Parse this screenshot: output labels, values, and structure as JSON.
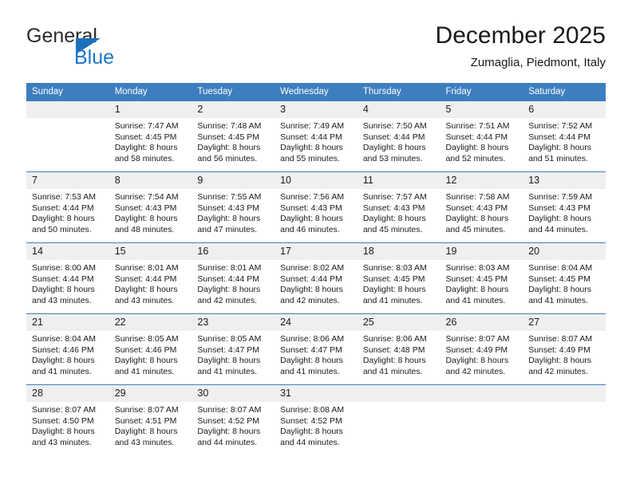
{
  "brand": {
    "name_top": "General",
    "name_bottom": "Blue",
    "accent_color": "#1b76c6"
  },
  "header": {
    "title": "December 2025",
    "subtitle": "Zumaglia, Piedmont, Italy"
  },
  "theme": {
    "header_blue": "#3d7ebf",
    "daynum_gray": "#efefef"
  },
  "weekday_headers": [
    "Sunday",
    "Monday",
    "Tuesday",
    "Wednesday",
    "Thursday",
    "Friday",
    "Saturday"
  ],
  "weeks": [
    [
      {
        "day": "",
        "sunrise": "",
        "sunset": "",
        "daylight_line1": "",
        "daylight_line2": ""
      },
      {
        "day": "1",
        "sunrise": "Sunrise: 7:47 AM",
        "sunset": "Sunset: 4:45 PM",
        "daylight_line1": "Daylight: 8 hours",
        "daylight_line2": "and 58 minutes."
      },
      {
        "day": "2",
        "sunrise": "Sunrise: 7:48 AM",
        "sunset": "Sunset: 4:45 PM",
        "daylight_line1": "Daylight: 8 hours",
        "daylight_line2": "and 56 minutes."
      },
      {
        "day": "3",
        "sunrise": "Sunrise: 7:49 AM",
        "sunset": "Sunset: 4:44 PM",
        "daylight_line1": "Daylight: 8 hours",
        "daylight_line2": "and 55 minutes."
      },
      {
        "day": "4",
        "sunrise": "Sunrise: 7:50 AM",
        "sunset": "Sunset: 4:44 PM",
        "daylight_line1": "Daylight: 8 hours",
        "daylight_line2": "and 53 minutes."
      },
      {
        "day": "5",
        "sunrise": "Sunrise: 7:51 AM",
        "sunset": "Sunset: 4:44 PM",
        "daylight_line1": "Daylight: 8 hours",
        "daylight_line2": "and 52 minutes."
      },
      {
        "day": "6",
        "sunrise": "Sunrise: 7:52 AM",
        "sunset": "Sunset: 4:44 PM",
        "daylight_line1": "Daylight: 8 hours",
        "daylight_line2": "and 51 minutes."
      }
    ],
    [
      {
        "day": "7",
        "sunrise": "Sunrise: 7:53 AM",
        "sunset": "Sunset: 4:44 PM",
        "daylight_line1": "Daylight: 8 hours",
        "daylight_line2": "and 50 minutes."
      },
      {
        "day": "8",
        "sunrise": "Sunrise: 7:54 AM",
        "sunset": "Sunset: 4:43 PM",
        "daylight_line1": "Daylight: 8 hours",
        "daylight_line2": "and 48 minutes."
      },
      {
        "day": "9",
        "sunrise": "Sunrise: 7:55 AM",
        "sunset": "Sunset: 4:43 PM",
        "daylight_line1": "Daylight: 8 hours",
        "daylight_line2": "and 47 minutes."
      },
      {
        "day": "10",
        "sunrise": "Sunrise: 7:56 AM",
        "sunset": "Sunset: 4:43 PM",
        "daylight_line1": "Daylight: 8 hours",
        "daylight_line2": "and 46 minutes."
      },
      {
        "day": "11",
        "sunrise": "Sunrise: 7:57 AM",
        "sunset": "Sunset: 4:43 PM",
        "daylight_line1": "Daylight: 8 hours",
        "daylight_line2": "and 45 minutes."
      },
      {
        "day": "12",
        "sunrise": "Sunrise: 7:58 AM",
        "sunset": "Sunset: 4:43 PM",
        "daylight_line1": "Daylight: 8 hours",
        "daylight_line2": "and 45 minutes."
      },
      {
        "day": "13",
        "sunrise": "Sunrise: 7:59 AM",
        "sunset": "Sunset: 4:43 PM",
        "daylight_line1": "Daylight: 8 hours",
        "daylight_line2": "and 44 minutes."
      }
    ],
    [
      {
        "day": "14",
        "sunrise": "Sunrise: 8:00 AM",
        "sunset": "Sunset: 4:44 PM",
        "daylight_line1": "Daylight: 8 hours",
        "daylight_line2": "and 43 minutes."
      },
      {
        "day": "15",
        "sunrise": "Sunrise: 8:01 AM",
        "sunset": "Sunset: 4:44 PM",
        "daylight_line1": "Daylight: 8 hours",
        "daylight_line2": "and 43 minutes."
      },
      {
        "day": "16",
        "sunrise": "Sunrise: 8:01 AM",
        "sunset": "Sunset: 4:44 PM",
        "daylight_line1": "Daylight: 8 hours",
        "daylight_line2": "and 42 minutes."
      },
      {
        "day": "17",
        "sunrise": "Sunrise: 8:02 AM",
        "sunset": "Sunset: 4:44 PM",
        "daylight_line1": "Daylight: 8 hours",
        "daylight_line2": "and 42 minutes."
      },
      {
        "day": "18",
        "sunrise": "Sunrise: 8:03 AM",
        "sunset": "Sunset: 4:45 PM",
        "daylight_line1": "Daylight: 8 hours",
        "daylight_line2": "and 41 minutes."
      },
      {
        "day": "19",
        "sunrise": "Sunrise: 8:03 AM",
        "sunset": "Sunset: 4:45 PM",
        "daylight_line1": "Daylight: 8 hours",
        "daylight_line2": "and 41 minutes."
      },
      {
        "day": "20",
        "sunrise": "Sunrise: 8:04 AM",
        "sunset": "Sunset: 4:45 PM",
        "daylight_line1": "Daylight: 8 hours",
        "daylight_line2": "and 41 minutes."
      }
    ],
    [
      {
        "day": "21",
        "sunrise": "Sunrise: 8:04 AM",
        "sunset": "Sunset: 4:46 PM",
        "daylight_line1": "Daylight: 8 hours",
        "daylight_line2": "and 41 minutes."
      },
      {
        "day": "22",
        "sunrise": "Sunrise: 8:05 AM",
        "sunset": "Sunset: 4:46 PM",
        "daylight_line1": "Daylight: 8 hours",
        "daylight_line2": "and 41 minutes."
      },
      {
        "day": "23",
        "sunrise": "Sunrise: 8:05 AM",
        "sunset": "Sunset: 4:47 PM",
        "daylight_line1": "Daylight: 8 hours",
        "daylight_line2": "and 41 minutes."
      },
      {
        "day": "24",
        "sunrise": "Sunrise: 8:06 AM",
        "sunset": "Sunset: 4:47 PM",
        "daylight_line1": "Daylight: 8 hours",
        "daylight_line2": "and 41 minutes."
      },
      {
        "day": "25",
        "sunrise": "Sunrise: 8:06 AM",
        "sunset": "Sunset: 4:48 PM",
        "daylight_line1": "Daylight: 8 hours",
        "daylight_line2": "and 41 minutes."
      },
      {
        "day": "26",
        "sunrise": "Sunrise: 8:07 AM",
        "sunset": "Sunset: 4:49 PM",
        "daylight_line1": "Daylight: 8 hours",
        "daylight_line2": "and 42 minutes."
      },
      {
        "day": "27",
        "sunrise": "Sunrise: 8:07 AM",
        "sunset": "Sunset: 4:49 PM",
        "daylight_line1": "Daylight: 8 hours",
        "daylight_line2": "and 42 minutes."
      }
    ],
    [
      {
        "day": "28",
        "sunrise": "Sunrise: 8:07 AM",
        "sunset": "Sunset: 4:50 PM",
        "daylight_line1": "Daylight: 8 hours",
        "daylight_line2": "and 43 minutes."
      },
      {
        "day": "29",
        "sunrise": "Sunrise: 8:07 AM",
        "sunset": "Sunset: 4:51 PM",
        "daylight_line1": "Daylight: 8 hours",
        "daylight_line2": "and 43 minutes."
      },
      {
        "day": "30",
        "sunrise": "Sunrise: 8:07 AM",
        "sunset": "Sunset: 4:52 PM",
        "daylight_line1": "Daylight: 8 hours",
        "daylight_line2": "and 44 minutes."
      },
      {
        "day": "31",
        "sunrise": "Sunrise: 8:08 AM",
        "sunset": "Sunset: 4:52 PM",
        "daylight_line1": "Daylight: 8 hours",
        "daylight_line2": "and 44 minutes."
      },
      {
        "day": "",
        "sunrise": "",
        "sunset": "",
        "daylight_line1": "",
        "daylight_line2": ""
      },
      {
        "day": "",
        "sunrise": "",
        "sunset": "",
        "daylight_line1": "",
        "daylight_line2": ""
      },
      {
        "day": "",
        "sunrise": "",
        "sunset": "",
        "daylight_line1": "",
        "daylight_line2": ""
      }
    ]
  ]
}
